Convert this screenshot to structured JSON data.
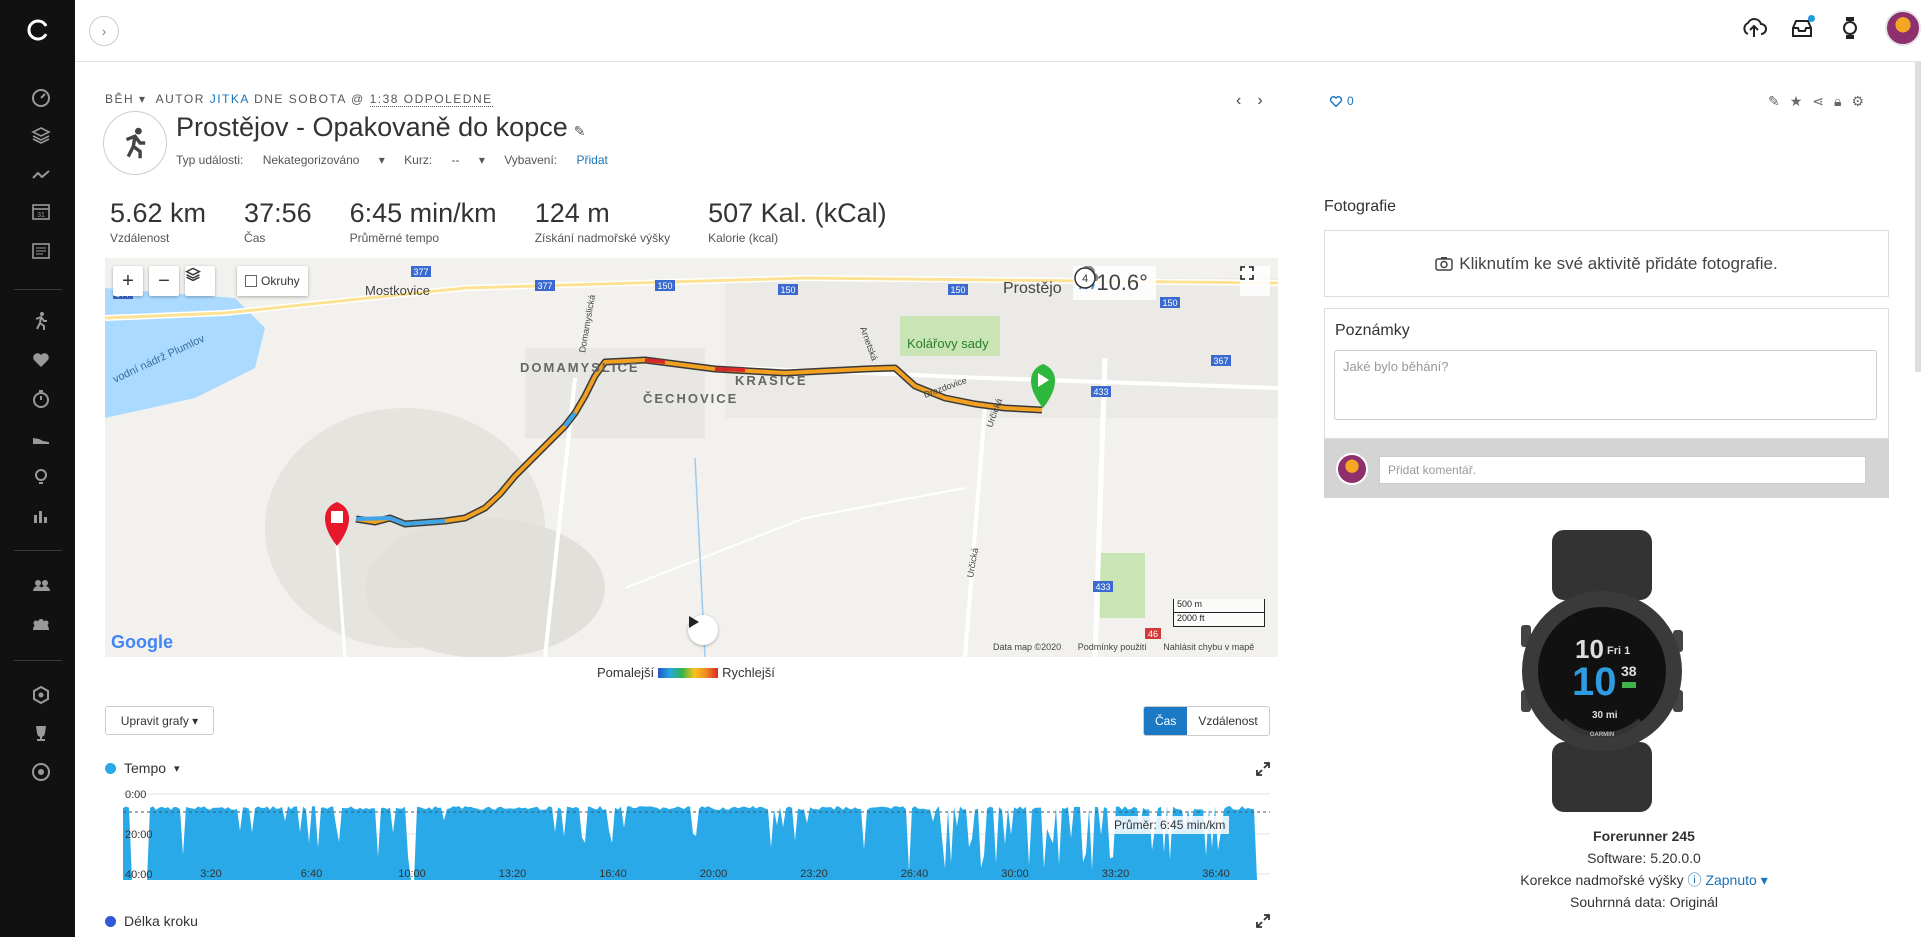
{
  "sidebar": {
    "icons": [
      "dashboard-icon",
      "layers-icon",
      "activity-trend-icon",
      "calendar-icon",
      "news-icon",
      "running-figure-icon",
      "heart-icon",
      "stopwatch-icon",
      "shoe-icon",
      "lightbulb-icon",
      "bar-chart-icon",
      "connections-icon",
      "groups-icon",
      "badge-icon",
      "trophy-icon",
      "target-icon"
    ],
    "calendar_day": "31"
  },
  "header": {
    "icons": [
      "upload-icon",
      "inbox-icon",
      "watch-icon",
      "avatar"
    ]
  },
  "activity": {
    "type": "BĚH",
    "author_prefix": "AUTOR",
    "author": "JITKA",
    "date_text": "DNE SOBOTA @",
    "time": "1:38 ODPOLEDNE",
    "title": "Prostějov - Opakovaně do kopce",
    "event_type_label": "Typ události:",
    "event_type_value": "Nekategorizováno",
    "course_label": "Kurz:",
    "course_value": "--",
    "gear_label": "Vybavení:",
    "gear_value": "Přidat"
  },
  "stats": [
    {
      "value": "5.62 km",
      "label": "Vzdálenost"
    },
    {
      "value": "37:56",
      "label": "Čas"
    },
    {
      "value": "6:45 min/km",
      "label": "Průměrné tempo"
    },
    {
      "value": "124 m",
      "label": "Získání nadmořské výšky"
    },
    {
      "value": "507 Kal. (kCal)",
      "label": "Kalorie (kcal)"
    }
  ],
  "map": {
    "okruhy_label": "Okruhy",
    "temperature": "10.6°",
    "wind": "4",
    "place_labels": [
      "Mostkovice",
      "DOMAMYSLICE",
      "ČECHOVICE",
      "KRASICE",
      "Kolářovy sady",
      "Prostějo",
      "Domamyslická",
      "Arnetská",
      "Drozdovice",
      "Určická",
      "Určická",
      "vodní nádrž Plumlov"
    ],
    "road_labels": [
      "377",
      "377",
      "377",
      "150",
      "150",
      "150",
      "150",
      "433",
      "433",
      "367",
      "46"
    ],
    "scale_m": "500 m",
    "scale_ft": "2000 ft",
    "attribution": "Data map ©2020",
    "terms": "Podmínky použití",
    "report": "Nahlásit chybu v mapě",
    "google": "Google"
  },
  "legend": {
    "slow": "Pomalejší",
    "fast": "Rychlejší"
  },
  "charts_controls": {
    "edit_label": "Upravit grafy ▾",
    "time_label": "Čas",
    "distance_label": "Vzdálenost"
  },
  "pace_chart": {
    "title": "Tempo",
    "y_ticks": [
      "0:00",
      "20:00",
      "40:00"
    ],
    "x_ticks": [
      "3:20",
      "6:40",
      "10:00",
      "13:20",
      "16:40",
      "20:00",
      "23:20",
      "26:40",
      "30:00",
      "33:20",
      "36:40"
    ],
    "avg_label": "Průměr: 6:45 min/km",
    "color": "#29a9e8"
  },
  "cadence_chart": {
    "title": "Délka kroku",
    "color": "#3158d8"
  },
  "right": {
    "likes": "0",
    "photos_title": "Fotografie",
    "photos_prompt": "Kliknutím ke své aktivitě přidáte fotografie.",
    "notes_title": "Poznámky",
    "notes_placeholder": "Jaké bylo běhání?",
    "comment_placeholder": "Přidat komentář.",
    "device_name": "Forerunner 245",
    "software_label": "Software:",
    "software_value": "5.20.0.0",
    "elev_corr_label": "Korekce nadmořské výšky",
    "elev_corr_value": "Zapnuto",
    "summary_label": "Souhrnná data:",
    "summary_value": "Originál",
    "watch_time_h": "10",
    "watch_time_big": "10",
    "watch_secs": "38",
    "watch_day": "Fri 1",
    "watch_dist": "30 mi",
    "watch_brand": "GARMIN"
  }
}
